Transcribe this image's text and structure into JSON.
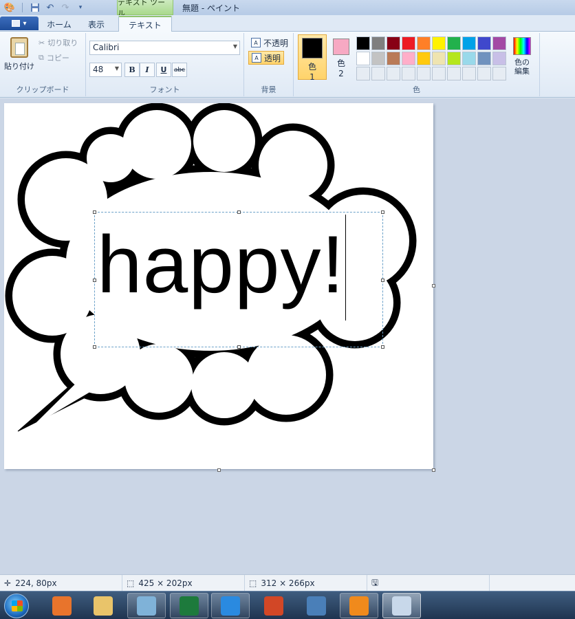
{
  "titlebar": {
    "context_tab": "テキスト ツール",
    "window_title": "無題 - ペイント",
    "qat_icons": [
      "paint-app-icon",
      "save-icon",
      "undo-icon",
      "redo-icon",
      "customize-qat-icon"
    ]
  },
  "tabs": {
    "app_menu_icon": "app-menu-icon",
    "items": [
      {
        "label": "ホーム",
        "active": false
      },
      {
        "label": "表示",
        "active": false
      },
      {
        "label": "テキスト",
        "active": true
      }
    ]
  },
  "ribbon": {
    "clipboard": {
      "label": "クリップボード",
      "paste": "貼り付け",
      "cut": "切り取り",
      "copy": "コピー"
    },
    "font": {
      "label": "フォント",
      "family": "Calibri",
      "size": "48",
      "bold": "B",
      "italic": "I",
      "underline": "U",
      "strikethrough": "abc"
    },
    "background": {
      "label": "背景",
      "opaque": "不透明",
      "transparent": "透明",
      "selected": "transparent"
    },
    "colors": {
      "label": "色",
      "color1": {
        "label": "色",
        "num": "1",
        "value": "#000000"
      },
      "color2": {
        "label": "色",
        "num": "2",
        "value": "#f7a9c3"
      },
      "edit": "色の\n編集",
      "palette": [
        "#000000",
        "#7f7f7f",
        "#880015",
        "#ed1c24",
        "#ff7f27",
        "#fff200",
        "#22b14c",
        "#00a2e8",
        "#3f48cc",
        "#a349a4",
        "#ffffff",
        "#c3c3c3",
        "#b97a57",
        "#ffaec9",
        "#ffc90e",
        "#efe4b0",
        "#b5e61d",
        "#99d9ea",
        "#7092be",
        "#c8bfe7",
        "#e6ecf3",
        "#e6ecf3",
        "#e6ecf3",
        "#e6ecf3",
        "#e6ecf3",
        "#e6ecf3",
        "#e6ecf3",
        "#e6ecf3",
        "#e6ecf3",
        "#e6ecf3"
      ]
    }
  },
  "canvas": {
    "text": "happy!",
    "shape": "speech-bubble-cloud"
  },
  "statusbar": {
    "cursor_pos": "224, 80px",
    "selection_size": "425 × 202px",
    "image_size": "312 × 266px"
  },
  "taskbar": {
    "apps": [
      {
        "name": "media-player-icon",
        "color": "#e8742c"
      },
      {
        "name": "file-explorer-icon",
        "color": "#e9c46a"
      },
      {
        "name": "notebook-icon",
        "color": "#7fb2d8"
      },
      {
        "name": "excel-icon",
        "color": "#1d7a3c"
      },
      {
        "name": "internet-explorer-icon",
        "color": "#2a8ae0"
      },
      {
        "name": "powerpoint-icon",
        "color": "#d24726"
      },
      {
        "name": "video-editor-icon",
        "color": "#4a7fb8"
      },
      {
        "name": "douga-app-icon",
        "color": "#f08a1c"
      },
      {
        "name": "paint-icon",
        "color": "#c8d8ea"
      }
    ]
  }
}
